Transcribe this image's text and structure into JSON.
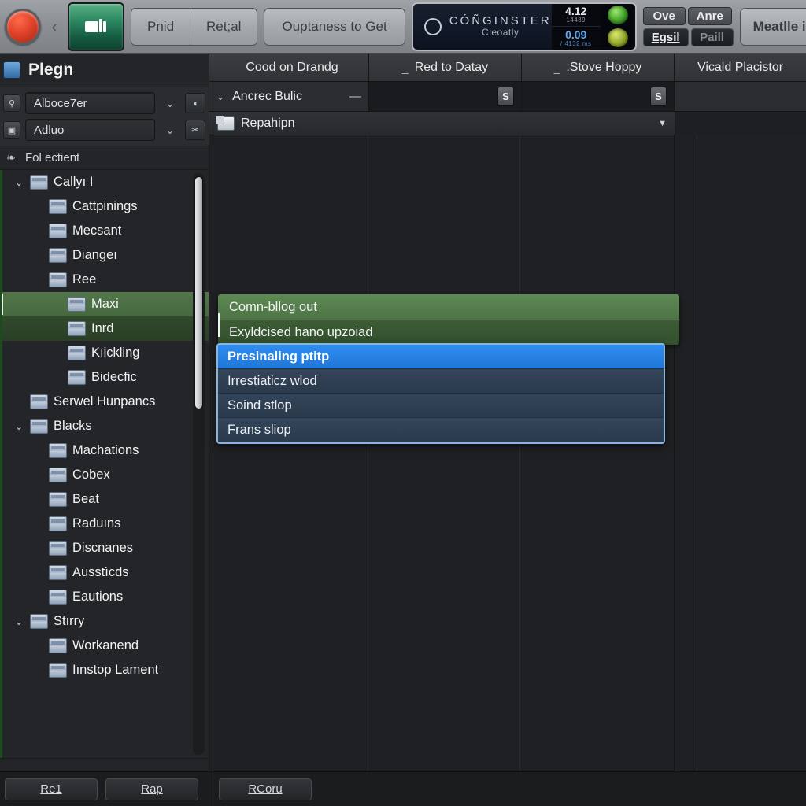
{
  "toolbar": {
    "record_button": "record-button",
    "back_chevron": "‹",
    "tile_icon": "windows-icon",
    "segmented": [
      "Pnid",
      "Ret;al"
    ],
    "outcome_button": "Ouptaness to Get",
    "lcd": {
      "brand": "CÓÑGINSTER",
      "sub": "Cleoatly",
      "num_top": "4.12",
      "num_top_sub": "14439",
      "num_bottom": "0.09",
      "num_bottom_sub": "/ 4132 ms"
    },
    "quad_buttons": [
      "Ove",
      "Anre",
      "Egsil",
      "Paill"
    ],
    "right_button": "Meatlle inr"
  },
  "sidebar": {
    "title": "Plegn",
    "title_icon": "app-icon",
    "combo_rows": [
      {
        "icon": "link-icon",
        "value": "Alboce7er",
        "chevron": "⌄",
        "button_icon": "bell-icon"
      },
      {
        "icon": "image-icon",
        "value": "Adluo",
        "chevron": "⌄",
        "button_icon": "scissors-icon"
      }
    ],
    "section_label": "Fol ectient",
    "section_icon": "folder-gear-icon",
    "tree": [
      {
        "label": "Callyı I",
        "level": 0,
        "twisty": "⌄",
        "chevron": "",
        "state": "none"
      },
      {
        "label": "Cattpinings",
        "level": 1,
        "twisty": "",
        "chevron": "",
        "state": "none"
      },
      {
        "label": "Mecsant",
        "level": 1,
        "twisty": "",
        "chevron": "⌄",
        "state": "none"
      },
      {
        "label": "Diangeı",
        "level": 1,
        "twisty": "",
        "chevron": "⌄",
        "state": "none"
      },
      {
        "label": "Ree",
        "level": 1,
        "twisty": "",
        "chevron": "⌄",
        "state": "none"
      },
      {
        "label": "Maxi",
        "level": 2,
        "twisty": "",
        "chevron": "⌄",
        "state": "selected"
      },
      {
        "label": "Inrd",
        "level": 2,
        "twisty": "",
        "chevron": "⌄",
        "state": "highlight"
      },
      {
        "label": "Kıickling",
        "level": 2,
        "twisty": "",
        "chevron": "⌄",
        "state": "none"
      },
      {
        "label": "Bidecfic",
        "level": 2,
        "twisty": "",
        "chevron": "⌄",
        "state": "none"
      },
      {
        "label": "Serwel Hunpancs",
        "level": 0,
        "twisty": "",
        "chevron": "",
        "state": "none"
      },
      {
        "label": "Blacks",
        "level": 0,
        "twisty": "⌄",
        "chevron": "",
        "state": "none"
      },
      {
        "label": "Machations",
        "level": 1,
        "twisty": "",
        "chevron": "",
        "state": "none"
      },
      {
        "label": "Cobex",
        "level": 1,
        "twisty": "",
        "chevron": "",
        "state": "none"
      },
      {
        "label": "Beat",
        "level": 1,
        "twisty": "",
        "chevron": "",
        "state": "none"
      },
      {
        "label": "Raduıns",
        "level": 1,
        "twisty": "",
        "chevron": "",
        "state": "none"
      },
      {
        "label": "Discnanes",
        "level": 1,
        "twisty": "",
        "chevron": "",
        "state": "none"
      },
      {
        "label": "Ausstìcds",
        "level": 1,
        "twisty": "",
        "chevron": "",
        "state": "none"
      },
      {
        "label": "Eautions",
        "level": 1,
        "twisty": "",
        "chevron": "",
        "state": "none"
      },
      {
        "label": "Stırry",
        "level": 0,
        "twisty": "⌄",
        "chevron": "",
        "state": "none"
      },
      {
        "label": "Workanend",
        "level": 1,
        "twisty": "",
        "chevron": "",
        "state": "none"
      },
      {
        "label": "Iınstop Lament",
        "level": 1,
        "twisty": "",
        "chevron": "",
        "state": "none"
      }
    ]
  },
  "main": {
    "tabs": [
      {
        "label": "Cood on Drandg",
        "dash": ""
      },
      {
        "label": "Red to Datay",
        "dash": "_"
      },
      {
        "label": ".Stove Hoppy",
        "dash": "_"
      },
      {
        "label": "Vicald Placistor",
        "dash": ""
      }
    ],
    "second_row": {
      "group_label": "Ancrec Bulic",
      "group_chevron": "⌄",
      "group_minus": "—",
      "badge": "S"
    },
    "repeat_row": {
      "label": "Repahipn",
      "caret": "▼",
      "icon": "clips-icon"
    }
  },
  "overlay": {
    "green_items": [
      "Comn-bllog out",
      "Exyldcised hano upzoiad"
    ],
    "blue_items": [
      {
        "label": "Presinaling ptitp",
        "selected": true
      },
      {
        "label": "Irrestiaticz wlod",
        "selected": false
      },
      {
        "label": "Soind stlop",
        "selected": false
      },
      {
        "label": "Frans sliop",
        "selected": false
      }
    ]
  },
  "bottom": {
    "buttons": [
      "Re1",
      "Rap"
    ],
    "right_button": "RCoru"
  },
  "colors": {
    "accent_blue": "#2f8ef0",
    "accent_green": "#5d8a53",
    "panel_bg": "#1f2023",
    "sidebar_bg": "#242528"
  }
}
